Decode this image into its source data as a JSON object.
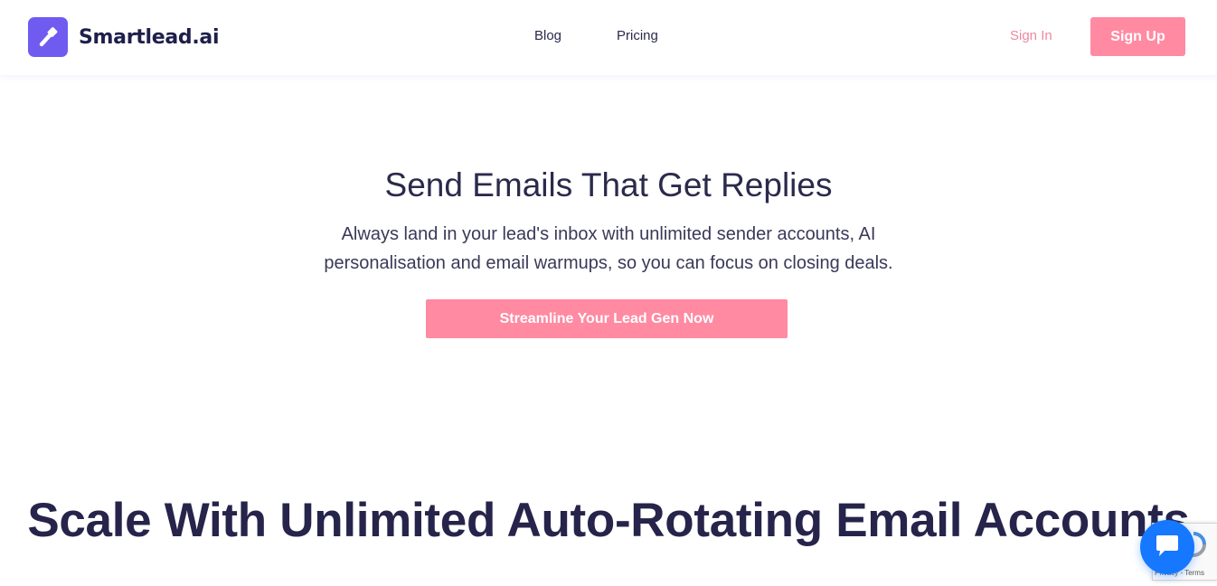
{
  "brand": {
    "name": "Smartlead.ai",
    "accent_color": "#6f5bf0",
    "cta_color": "#ff8aa2",
    "text_color": "#2b2a4c"
  },
  "nav": {
    "blog": "Blog",
    "pricing": "Pricing",
    "sign_in": "Sign In",
    "sign_up": "Sign Up"
  },
  "hero": {
    "title": "Send Emails That Get Replies",
    "subtitle": "Always land in your lead's inbox with unlimited sender accounts, AI personalisation and email warmups, so you can focus on closing deals.",
    "cta": "Streamline Your Lead Gen Now"
  },
  "section": {
    "title": "Scale With Unlimited Auto-Rotating Email Accounts"
  },
  "recaptcha": {
    "links": "Privacy - Terms"
  },
  "icons": {
    "logo": "torch-icon",
    "chat": "chat-bubble-icon",
    "recaptcha": "recaptcha-icon"
  }
}
